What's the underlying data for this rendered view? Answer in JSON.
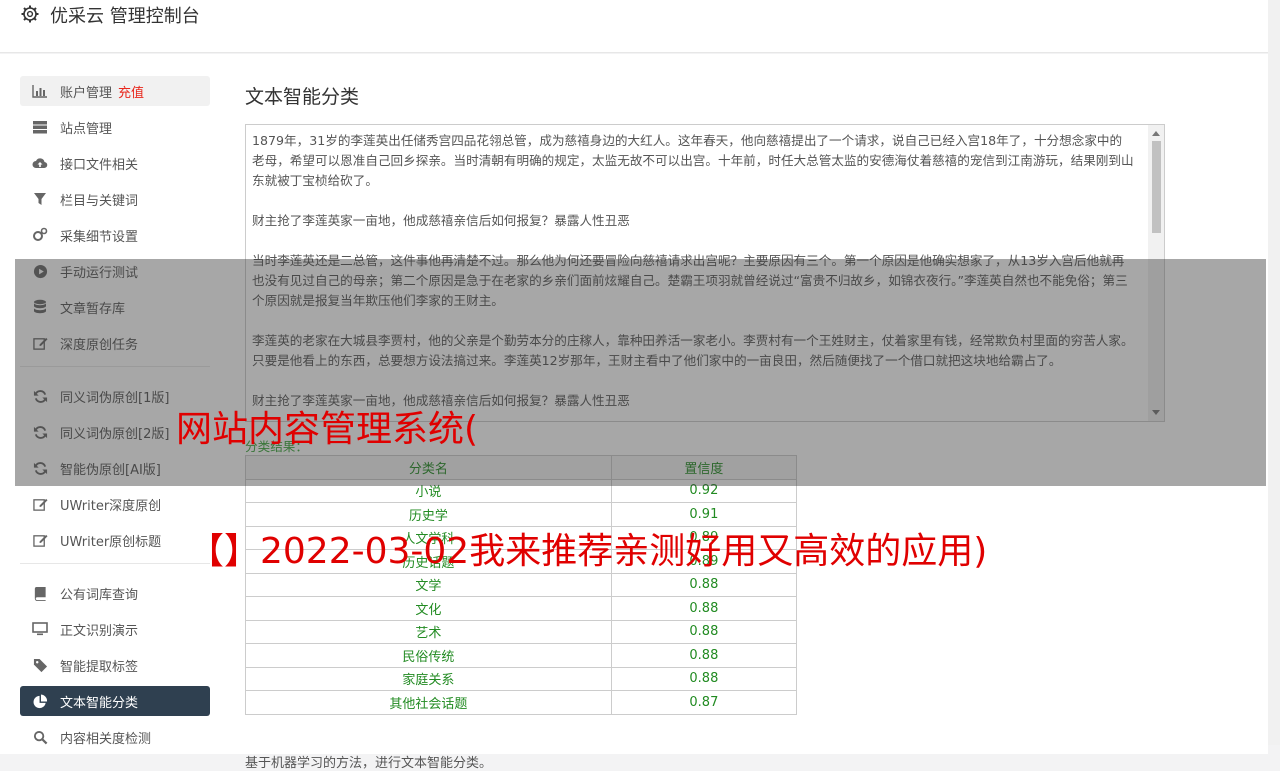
{
  "app": {
    "title": "优采云 管理控制台"
  },
  "sidebar": {
    "items": [
      {
        "label": "账户管理",
        "badge": "充值",
        "icon": "bar-chart-icon"
      },
      {
        "label": "站点管理",
        "icon": "server-icon"
      },
      {
        "label": "接口文件相关",
        "icon": "cloud-upload-icon"
      },
      {
        "label": "栏目与关键词",
        "icon": "filter-icon"
      },
      {
        "label": "采集细节设置",
        "icon": "gears-icon"
      },
      {
        "label": "手动运行测试",
        "icon": "play-icon"
      },
      {
        "label": "文章暂存库",
        "icon": "database-icon"
      },
      {
        "label": "深度原创任务",
        "icon": "edit-icon"
      },
      {
        "label": "同义词伪原创[1版]",
        "icon": "refresh-icon"
      },
      {
        "label": "同义词伪原创[2版]",
        "icon": "refresh-icon"
      },
      {
        "label": "智能伪原创[AI版]",
        "icon": "refresh-icon"
      },
      {
        "label": "UWriter深度原创",
        "icon": "edit-icon"
      },
      {
        "label": "UWriter原创标题",
        "icon": "edit-icon"
      },
      {
        "label": "公有词库查询",
        "icon": "book-icon"
      },
      {
        "label": "正文识别演示",
        "icon": "monitor-icon"
      },
      {
        "label": "智能提取标签",
        "icon": "tag-icon"
      },
      {
        "label": "文本智能分类",
        "icon": "pie-chart-icon"
      },
      {
        "label": "内容相关度检测",
        "icon": "search-icon"
      }
    ]
  },
  "main": {
    "heading": "文本智能分类",
    "article": [
      "1879年，31岁的李莲英出任储秀宫四品花翎总管，成为慈禧身边的大红人。这年春天，他向慈禧提出了一个请求，说自己已经入宫18年了，十分想念家中的老母，希望可以恩准自己回乡探亲。当时清朝有明确的规定，太监无故不可以出宫。十年前，时任大总管太监的安德海仗着慈禧的宠信到江南游玩，结果刚到山东就被丁宝桢给砍了。",
      "财主抢了李莲英家一亩地，他成慈禧亲信后如何报复？暴露人性丑恶",
      "当时李莲英还是二总管，这件事他再清楚不过。那么他为何还要冒险向慈禧请求出宫呢？主要原因有三个。第一个原因是他确实想家了，从13岁入宫后他就再也没有见过自己的母亲；第二个原因是急于在老家的乡亲们面前炫耀自己。楚霸王项羽就曾经说过“富贵不归故乡，如锦衣夜行。”李莲英自然也不能免俗；第三个原因就是报复当年欺压他们李家的王财主。",
      "李莲英的老家在大城县李贾村，他的父亲是个勤劳本分的庄稼人，靠种田养活一家老小。李贾村有一个王姓财主，仗着家里有钱，经常欺负村里面的穷苦人家。只要是他看上的东西，总要想方设法搞过来。李莲英12岁那年，王财主看中了他们家中的一亩良田，然后随便找了一个借口就把这块地给霸占了。",
      "财主抢了李莲英家一亩地，他成慈禧亲信后如何报复？暴露人性丑恶"
    ],
    "result_label": "分类结果：",
    "table": {
      "headers": [
        "分类名",
        "置信度"
      ],
      "rows": [
        [
          "小说",
          "0.92"
        ],
        [
          "历史学",
          "0.91"
        ],
        [
          "人文学科",
          "0.89"
        ],
        [
          "历史话题",
          "0.89"
        ],
        [
          "文学",
          "0.88"
        ],
        [
          "文化",
          "0.88"
        ],
        [
          "艺术",
          "0.88"
        ],
        [
          "民俗传统",
          "0.88"
        ],
        [
          "家庭关系",
          "0.88"
        ],
        [
          "其他社会话题",
          "0.87"
        ]
      ]
    },
    "footnote": "基于机器学习的方法，进行文本智能分类。"
  },
  "overlay": {
    "line1": "网站内容管理系统(",
    "line2": "【】2022-03-02我来推荐亲测好用又高效的应用)"
  },
  "colors": {
    "accent": "#2f4050",
    "badge": "#e8271d",
    "result": "#228b22",
    "overlay_text": "#e00000"
  }
}
